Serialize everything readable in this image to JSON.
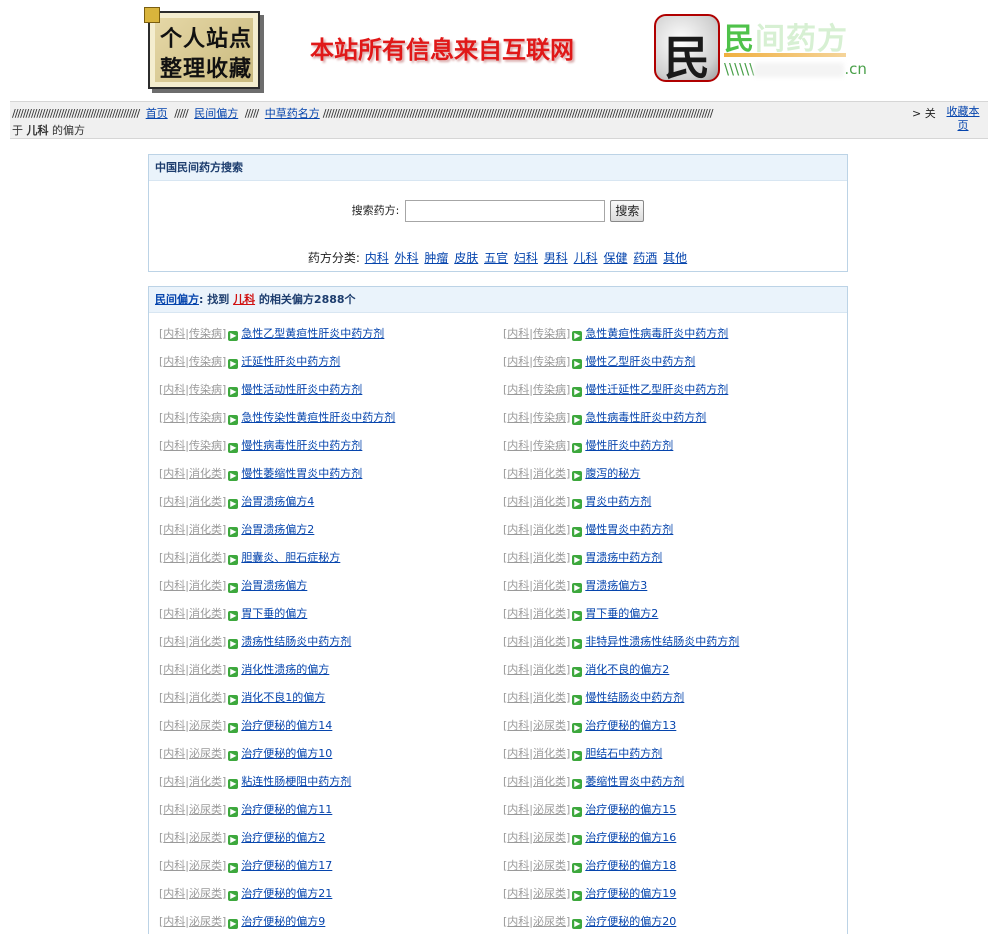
{
  "header": {
    "logo_line1": "个人站点",
    "logo_line2": "整理收藏",
    "slogan": "本站所有信息来自互联网",
    "brand_char": "民",
    "brand_name_a": "民",
    "brand_name_b": "间药方",
    "brand_url_prefix": "\\\\\\\\\\\\",
    "brand_url_suffix": ".cn"
  },
  "breadcrumb": {
    "prefix_slashes": "///////////////////////////////////////////////",
    "home": "首页",
    "sep1": "/////",
    "folk": "民间偏方",
    "sep2": "/////",
    "herbal": "中草药名方",
    "tail_slashes": "////////////////////////////////////////////////////////////////////////////////////////////////////////////////////////////////////////////////",
    "tail_end": "> 关",
    "line2_a": "于",
    "line2_kw": "儿科",
    "line2_b": "的偏方",
    "favorite": "收藏本页"
  },
  "search": {
    "title": "中国民间药方搜索",
    "label": "搜索药方:",
    "input_value": "",
    "button": "搜索",
    "category_label": "药方分类:",
    "categories": [
      "内科",
      "外科",
      "肿瘤",
      "皮肤",
      "五官",
      "妇科",
      "男科",
      "儿科",
      "保健",
      "药酒",
      "其他"
    ]
  },
  "results": {
    "head_link": "民间偏方",
    "head_text_a": ": 找到",
    "head_kw": "儿科",
    "head_text_b": "的相关偏方2888个",
    "rows": [
      [
        {
          "tag1": "内科",
          "tag2": "传染病",
          "title": "急性乙型黄疸性肝炎中药方剂"
        },
        {
          "tag1": "内科",
          "tag2": "传染病",
          "title": "急性黄疸性病毒肝炎中药方剂"
        }
      ],
      [
        {
          "tag1": "内科",
          "tag2": "传染病",
          "title": "迁延性肝炎中药方剂"
        },
        {
          "tag1": "内科",
          "tag2": "传染病",
          "title": "慢性乙型肝炎中药方剂"
        }
      ],
      [
        {
          "tag1": "内科",
          "tag2": "传染病",
          "title": "慢性活动性肝炎中药方剂"
        },
        {
          "tag1": "内科",
          "tag2": "传染病",
          "title": "慢性迁延性乙型肝炎中药方剂"
        }
      ],
      [
        {
          "tag1": "内科",
          "tag2": "传染病",
          "title": "急性传染性黄疸性肝炎中药方剂"
        },
        {
          "tag1": "内科",
          "tag2": "传染病",
          "title": "急性病毒性肝炎中药方剂"
        }
      ],
      [
        {
          "tag1": "内科",
          "tag2": "传染病",
          "title": "慢性病毒性肝炎中药方剂"
        },
        {
          "tag1": "内科",
          "tag2": "传染病",
          "title": "慢性肝炎中药方剂"
        }
      ],
      [
        {
          "tag1": "内科",
          "tag2": "消化类",
          "title": "慢性萎缩性胃炎中药方剂"
        },
        {
          "tag1": "内科",
          "tag2": "消化类",
          "title": "腹泻的秘方"
        }
      ],
      [
        {
          "tag1": "内科",
          "tag2": "消化类",
          "title": "治胃溃疡偏方4"
        },
        {
          "tag1": "内科",
          "tag2": "消化类",
          "title": "胃炎中药方剂"
        }
      ],
      [
        {
          "tag1": "内科",
          "tag2": "消化类",
          "title": "治胃溃疡偏方2"
        },
        {
          "tag1": "内科",
          "tag2": "消化类",
          "title": "慢性胃炎中药方剂"
        }
      ],
      [
        {
          "tag1": "内科",
          "tag2": "消化类",
          "title": "胆囊炎、胆石症秘方"
        },
        {
          "tag1": "内科",
          "tag2": "消化类",
          "title": "胃溃疡中药方剂"
        }
      ],
      [
        {
          "tag1": "内科",
          "tag2": "消化类",
          "title": "治胃溃疡偏方"
        },
        {
          "tag1": "内科",
          "tag2": "消化类",
          "title": "胃溃疡偏方3"
        }
      ],
      [
        {
          "tag1": "内科",
          "tag2": "消化类",
          "title": "胃下垂的偏方"
        },
        {
          "tag1": "内科",
          "tag2": "消化类",
          "title": "胃下垂的偏方2"
        }
      ],
      [
        {
          "tag1": "内科",
          "tag2": "消化类",
          "title": "溃疡性结肠炎中药方剂"
        },
        {
          "tag1": "内科",
          "tag2": "消化类",
          "title": "非特异性溃疡性结肠炎中药方剂"
        }
      ],
      [
        {
          "tag1": "内科",
          "tag2": "消化类",
          "title": "消化性溃疡的偏方"
        },
        {
          "tag1": "内科",
          "tag2": "消化类",
          "title": "消化不良的偏方2"
        }
      ],
      [
        {
          "tag1": "内科",
          "tag2": "消化类",
          "title": "消化不良1的偏方"
        },
        {
          "tag1": "内科",
          "tag2": "消化类",
          "title": "慢性结肠炎中药方剂"
        }
      ],
      [
        {
          "tag1": "内科",
          "tag2": "泌尿类",
          "title": "治疗便秘的偏方14"
        },
        {
          "tag1": "内科",
          "tag2": "泌尿类",
          "title": "治疗便秘的偏方13"
        }
      ],
      [
        {
          "tag1": "内科",
          "tag2": "泌尿类",
          "title": "治疗便秘的偏方10"
        },
        {
          "tag1": "内科",
          "tag2": "消化类",
          "title": "胆结石中药方剂"
        }
      ],
      [
        {
          "tag1": "内科",
          "tag2": "消化类",
          "title": "粘连性肠梗阻中药方剂"
        },
        {
          "tag1": "内科",
          "tag2": "消化类",
          "title": "萎缩性胃炎中药方剂"
        }
      ],
      [
        {
          "tag1": "内科",
          "tag2": "泌尿类",
          "title": "治疗便秘的偏方11"
        },
        {
          "tag1": "内科",
          "tag2": "泌尿类",
          "title": "治疗便秘的偏方15"
        }
      ],
      [
        {
          "tag1": "内科",
          "tag2": "泌尿类",
          "title": "治疗便秘的偏方2"
        },
        {
          "tag1": "内科",
          "tag2": "泌尿类",
          "title": "治疗便秘的偏方16"
        }
      ],
      [
        {
          "tag1": "内科",
          "tag2": "泌尿类",
          "title": "治疗便秘的偏方17"
        },
        {
          "tag1": "内科",
          "tag2": "泌尿类",
          "title": "治疗便秘的偏方18"
        }
      ],
      [
        {
          "tag1": "内科",
          "tag2": "泌尿类",
          "title": "治疗便秘的偏方21"
        },
        {
          "tag1": "内科",
          "tag2": "泌尿类",
          "title": "治疗便秘的偏方19"
        }
      ],
      [
        {
          "tag1": "内科",
          "tag2": "泌尿类",
          "title": "治疗便秘的偏方9"
        },
        {
          "tag1": "内科",
          "tag2": "泌尿类",
          "title": "治疗便秘的偏方20"
        }
      ]
    ]
  },
  "colors": {
    "slogan": "#e01818",
    "link": "#0645ad",
    "tag": "#9a9a9a",
    "box_border": "#bcd3e6",
    "box_head_bg": "#eaf3fb",
    "arrow_icon": "#3da83d",
    "keyword": "#d01010"
  },
  "icons": {
    "item_arrow": "green-arrow-icon",
    "brand": "min-character-logo-icon"
  }
}
